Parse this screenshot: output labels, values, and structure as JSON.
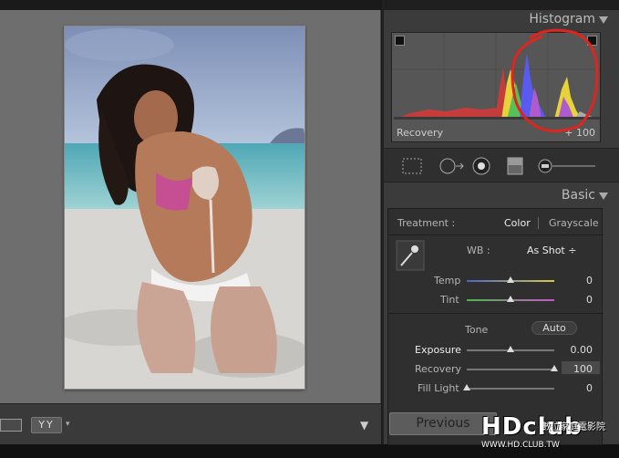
{
  "histogram": {
    "title": "Histogram",
    "readout_label": "Recovery",
    "readout_value": "+ 100"
  },
  "basic": {
    "title": "Basic",
    "treatment_label": "Treatment :",
    "treatment_color": "Color",
    "treatment_gray": "Grayscale",
    "wb_label": "WB :",
    "wb_value": "As Shot",
    "tone_label": "Tone",
    "auto_label": "Auto",
    "sliders": [
      {
        "label": "Temp",
        "value": "0",
        "fraction": 0.5
      },
      {
        "label": "Tint",
        "value": "0",
        "fraction": 0.5
      },
      {
        "label": "Exposure",
        "value": "0.00",
        "fraction": 0.5
      },
      {
        "label": "Recovery",
        "value": "100",
        "fraction": 1.0
      },
      {
        "label": "Fill Light",
        "value": "0",
        "fraction": 0.0
      }
    ]
  },
  "filmstrip": {
    "compare_label": "YY",
    "previous_label": "Previous"
  },
  "watermark": {
    "brand": "HDclub",
    "sub": "數位家庭電影院",
    "url": "WWW.HD.CLUB.TW"
  },
  "colors": {
    "annotation": "#e0241e",
    "panel_bg": "#3b3b3b",
    "viewer_bg": "#6e6e6e"
  }
}
